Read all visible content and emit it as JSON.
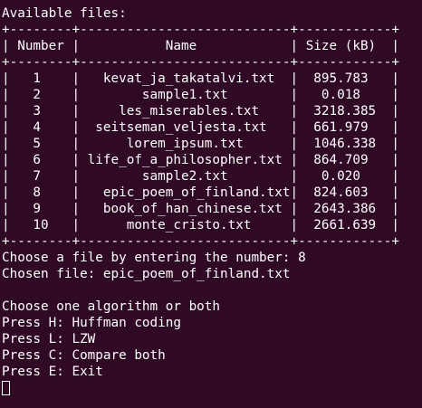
{
  "terminal": {
    "lines": [
      "Available files:",
      "+--------+---------------------------+------------+",
      "| Number |           Name            | Size (kB)  |",
      "+--------+---------------------------+------------+",
      "|   1    |   kevat_ja_takatalvi.txt  |  895.783   |",
      "|   2    |        sample1.txt        |   0.018    |",
      "|   3    |     les_miserables.txt    |  3218.385  |",
      "|   4    |  seitseman_veljesta.txt   |  661.979   |",
      "|   5    |      lorem_ipsum.txt      |  1046.338  |",
      "|   6    | life_of_a_philosopher.txt |  864.709   |",
      "|   7    |        sample2.txt        |   0.020    |",
      "|   8    |   epic_poem_of_finland.txt|  824.603   |",
      "|   9    |   book_of_han_chinese.txt |  2643.386  |",
      "|   10   |      monte_cristo.txt     |  2661.639  |",
      "+--------+---------------------------+------------+",
      "Choose a file by entering the number: 8",
      "Chosen file: epic_poem_of_finland.txt",
      "",
      "Choose one algorithm or both",
      "Press H: Huffman coding",
      "Press L: LZW",
      "Press C: Compare both",
      "Press E: Exit"
    ]
  },
  "colors": {
    "background": "#300a24",
    "foreground": "#ffffff"
  }
}
